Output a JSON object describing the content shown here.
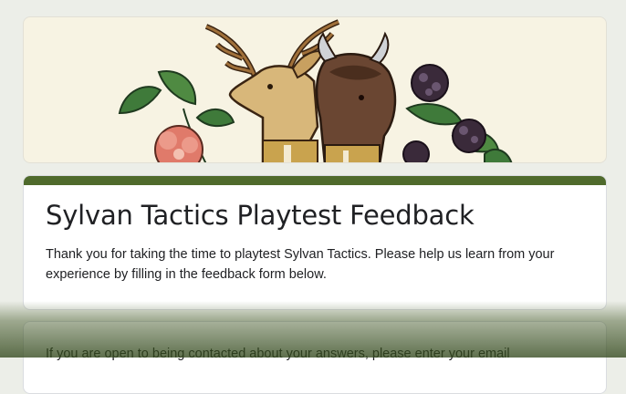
{
  "form": {
    "title": "Sylvan Tactics Playtest Feedback",
    "description": "Thank you for taking the time to playtest Sylvan Tactics. Please help us learn from your experience by filling in the feedback form below.",
    "next_question_text": "If you are open to being contacted about your answers, please enter your email"
  },
  "theme": {
    "accent_color": "#4f6a2c",
    "banner_background": "#f7f3e3",
    "page_background": "#eceee8"
  }
}
